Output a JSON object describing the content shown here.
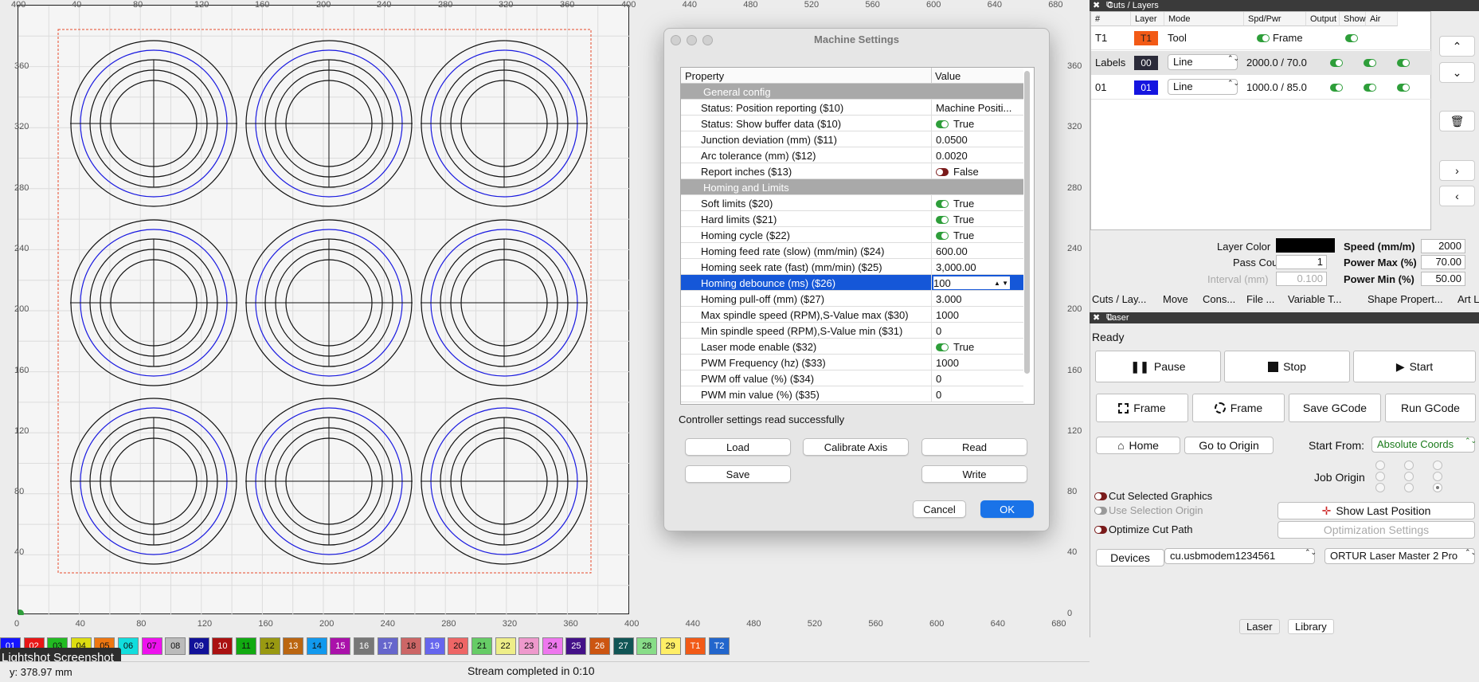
{
  "canvas": {
    "x_ticks": [
      "400",
      "40",
      "80",
      "120",
      "160",
      "200",
      "240",
      "280",
      "320",
      "360",
      "400",
      "440",
      "480",
      "520",
      "560",
      "600",
      "640",
      "680"
    ],
    "bottom_ticks": [
      "0",
      "40",
      "80",
      "120",
      "160",
      "200",
      "240",
      "280",
      "320",
      "360",
      "400",
      "440",
      "480",
      "520",
      "560",
      "600",
      "640",
      "680"
    ],
    "left_ticks": [
      "360",
      "320",
      "280",
      "240",
      "200",
      "160",
      "120",
      "80",
      "40"
    ],
    "right_ticks": [
      "360",
      "320",
      "280",
      "240",
      "200",
      "160",
      "120",
      "80",
      "40",
      "0"
    ]
  },
  "palette": [
    "01",
    "02",
    "03",
    "04",
    "05",
    "06",
    "07",
    "08",
    "09",
    "10",
    "11",
    "12",
    "13",
    "14",
    "15",
    "16",
    "17",
    "18",
    "19",
    "20",
    "21",
    "22",
    "23",
    "24",
    "25",
    "26",
    "27",
    "28",
    "29",
    "T1",
    "T2"
  ],
  "palette_colors": [
    "#1515ff",
    "#e81616",
    "#22bb22",
    "#dddd11",
    "#ee7711",
    "#11dddd",
    "#ee11ee",
    "#bbbbbb",
    "#111199",
    "#aa1111",
    "#11aa11",
    "#999911",
    "#bb6611",
    "#1199ee",
    "#aa11aa",
    "#777777",
    "#6666cc",
    "#cc6666",
    "#6666ee",
    "#ee6666",
    "#66cc66",
    "#eeee88",
    "#ee99cc",
    "#ee77ee",
    "#441188",
    "#cc5511",
    "#115555",
    "#88dd88",
    "#ffee66",
    "#f25a16",
    "#2266cc"
  ],
  "tooltip": "Lightshot Screenshot",
  "status": {
    "coord": "y: 378.97 mm",
    "stream": "Stream completed in 0:10"
  },
  "dialog": {
    "title": "Machine Settings",
    "col_property": "Property",
    "col_value": "Value",
    "rows": [
      {
        "type": "group",
        "k": "General config"
      },
      {
        "k": "Status: Position reporting ($10)",
        "v": "Machine Positi..."
      },
      {
        "k": "Status: Show buffer data ($10)",
        "v": "True",
        "toggle": "on"
      },
      {
        "k": "Junction deviation (mm) ($11)",
        "v": "0.0500"
      },
      {
        "k": "Arc tolerance (mm) ($12)",
        "v": "0.0020"
      },
      {
        "k": "Report inches ($13)",
        "v": "False",
        "toggle": "off"
      },
      {
        "type": "group",
        "k": "Homing and Limits"
      },
      {
        "k": "Soft limits ($20)",
        "v": "True",
        "toggle": "on"
      },
      {
        "k": "Hard limits ($21)",
        "v": "True",
        "toggle": "on"
      },
      {
        "k": "Homing cycle ($22)",
        "v": "True",
        "toggle": "on"
      },
      {
        "k": "Homing feed rate (slow) (mm/min) ($24)",
        "v": "600.00"
      },
      {
        "k": "Homing seek rate (fast) (mm/min) ($25)",
        "v": "3,000.00"
      },
      {
        "k": "Homing debounce (ms) ($26)",
        "v": "100",
        "selected": true
      },
      {
        "k": "Homing pull-off (mm) ($27)",
        "v": "3.000"
      },
      {
        "k": "Max spindle speed (RPM),S-Value max ($30)",
        "v": "1000"
      },
      {
        "k": "Min spindle speed (RPM),S-Value min ($31)",
        "v": "0"
      },
      {
        "k": "Laser mode enable ($32)",
        "v": "True",
        "toggle": "on"
      },
      {
        "k": "PWM Frequency (hz) ($33)",
        "v": "1000"
      },
      {
        "k": "PWM off value (%) ($34)",
        "v": "0"
      },
      {
        "k": "PWM min value (%) ($35)",
        "v": "0"
      }
    ],
    "message": "Controller settings read successfully",
    "buttons": {
      "load": "Load",
      "calibrate": "Calibrate Axis",
      "read": "Read",
      "save": "Save",
      "write": "Write",
      "cancel": "Cancel",
      "ok": "OK"
    }
  },
  "cuts": {
    "title": "Cuts / Layers",
    "headers": [
      "#",
      "Layer",
      "Mode",
      "Spd/Pwr",
      "Output",
      "Show",
      "Air"
    ],
    "rows": [
      {
        "num": "T1",
        "layer": "T1",
        "color": "#f25a16",
        "mode": "Tool",
        "spdpwr": "Frame"
      },
      {
        "num": "Labels",
        "layer": "00",
        "color": "#2b2b3a",
        "mode": "Line",
        "spdpwr": "2000.0 / 70.0"
      },
      {
        "num": "01",
        "layer": "01",
        "color": "#1515e0",
        "mode": "Line",
        "spdpwr": "1000.0 / 85.0"
      }
    ],
    "layer_color_label": "Layer Color",
    "pass_count_label": "Pass Count",
    "pass_count": "1",
    "interval_label": "Interval (mm)",
    "interval": "0.100",
    "speed_label": "Speed (mm/m)",
    "speed": "2000",
    "pmax_label": "Power Max (%)",
    "pmax": "70.00",
    "pmin_label": "Power Min (%)",
    "pmin": "50.00"
  },
  "tabs": [
    "Cuts / Lay...",
    "Move",
    "Cons...",
    "File ...",
    "Variable T...",
    "Shape Propert...",
    "Art Libr..."
  ],
  "laser": {
    "title": "Laser",
    "status": "Ready",
    "pause": "Pause",
    "stop": "Stop",
    "start": "Start",
    "frame1": "Frame",
    "frame2": "Frame",
    "save_gcode": "Save GCode",
    "run_gcode": "Run GCode",
    "home": "Home",
    "go_origin": "Go to Origin",
    "start_from_label": "Start From:",
    "start_from": "Absolute Coords",
    "job_origin": "Job Origin",
    "cut_selected": "Cut Selected Graphics",
    "use_selection": "Use Selection Origin",
    "optimize": "Optimize Cut Path",
    "show_last": "Show Last Position",
    "opt_settings": "Optimization Settings",
    "devices": "Devices",
    "port": "cu.usbmodem1234561",
    "machine": "ORTUR  Laser Master 2 Pro"
  },
  "bottom_tabs": [
    "Laser",
    "Library"
  ]
}
